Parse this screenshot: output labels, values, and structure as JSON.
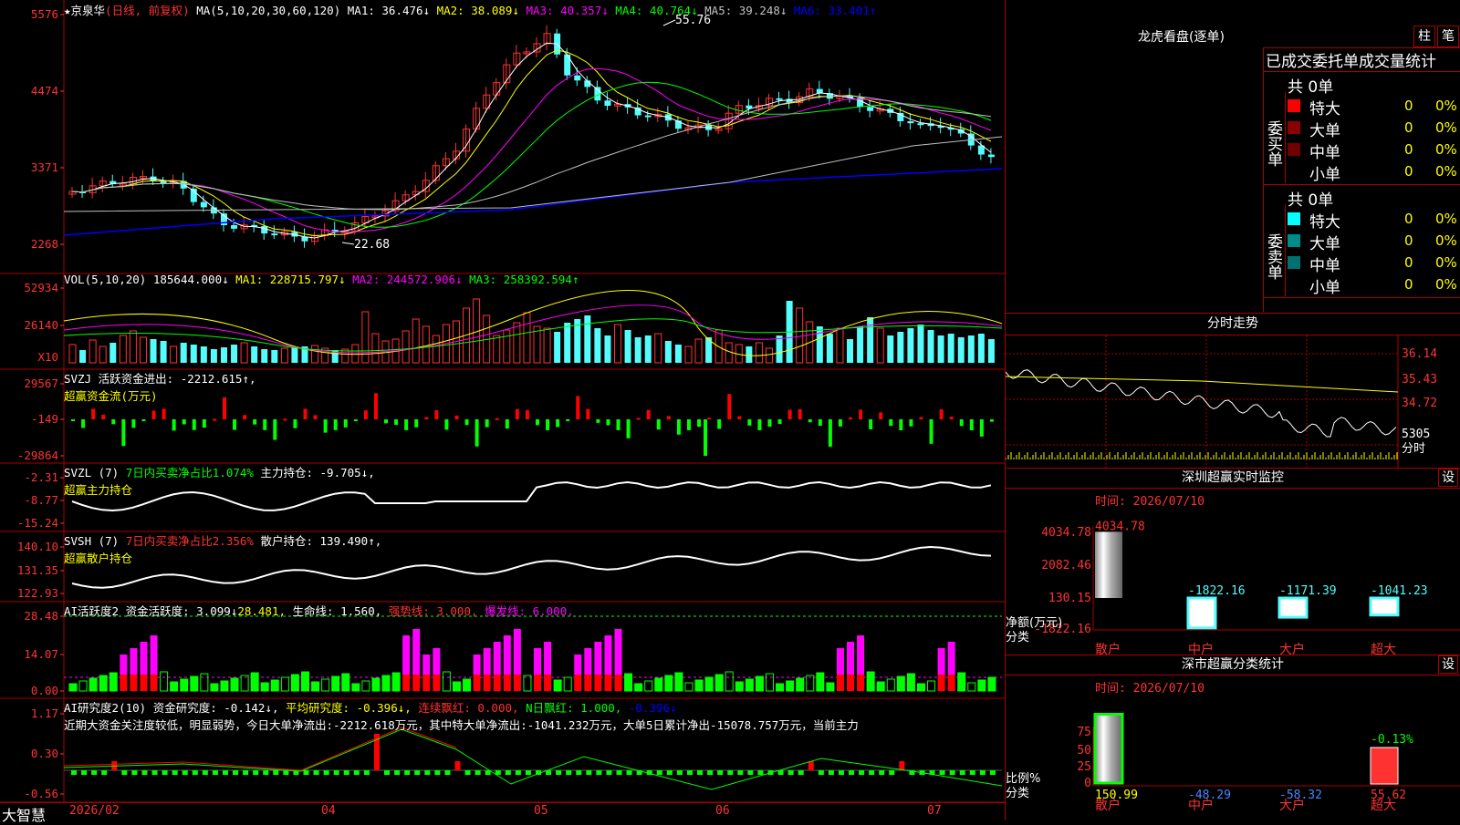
{
  "colors": {
    "up": "#ff3232",
    "down": "#54fcfc",
    "ma1": "#ffffff",
    "ma2": "#ffff00",
    "ma3": "#ff00ff",
    "ma4": "#00ff00",
    "ma5": "#c0c0c0",
    "ma6": "#0000ff",
    "magenta": "#ff00ff",
    "border": "#aa0000"
  },
  "main": {
    "star": "★",
    "stock": "京泉华",
    "mode": "(日线, 前复权)",
    "ma_def": "MA(5,10,20,30,60,120)",
    "ma": [
      {
        "label": "MA1: 36.476↓",
        "color": "#ffffff"
      },
      {
        "label": "MA2: 38.089↓",
        "color": "#ffff00"
      },
      {
        "label": "MA3: 40.357↓",
        "color": "#ff00ff"
      },
      {
        "label": "MA4: 40.764↓",
        "color": "#00ff00"
      },
      {
        "label": "MA5: 39.248↓",
        "color": "#c0c0c0"
      },
      {
        "label": "MA6: 33.401↑",
        "color": "#0000ff"
      }
    ],
    "yticks": [
      "5576",
      "4474",
      "3371",
      "2268"
    ],
    "high_label": "55.76",
    "low_label": "22.68"
  },
  "vol": {
    "title": "VOL(5,10,20)",
    "value": "185644.000↓",
    "ma1": "MA1: 228715.797↓",
    "ma2": "MA2: 244572.906↓",
    "ma3": "MA3: 258392.594↑",
    "yticks": [
      "52934",
      "26140"
    ],
    "unit": "X10"
  },
  "svzj": {
    "title": "SVZJ",
    "label": "活跃资金进出: -2212.615↑,",
    "sub": "超赢资金流(万元)",
    "yticks": [
      "29567",
      "-149",
      "-29864"
    ]
  },
  "svzl": {
    "title": "SVZL (7)",
    "label1": "7日内买卖净占比1.074%",
    "label2": "主力持仓: -9.705↓,",
    "sub": "超赢主力持仓",
    "yticks": [
      "-2.31",
      "-8.77",
      "-15.24"
    ]
  },
  "svsh": {
    "title": "SVSH (7)",
    "label1": "7日内买卖净占比2.356%",
    "label2": "散户持仓: 139.490↑,",
    "sub": "超赢散户持仓",
    "yticks": [
      "140.10",
      "131.35",
      "122.93"
    ]
  },
  "ai1": {
    "title": "AI活跃度2",
    "l1": "资金活跃度: 3.099↓",
    "l2": "28.481,",
    "l3": "生命线: 1.560,",
    "l4": "强势线: 3.000,",
    "l5": "爆发线: 6.000,",
    "yticks": [
      "28.48",
      "14.07",
      "0.00"
    ]
  },
  "ai2": {
    "title": "AI研究度2(10)",
    "l1": "资金研究度: -0.142↓,",
    "l2": "平均研究度: -0.396↓,",
    "l3": "连续飘红: 0.000,",
    "l4": "N日飘红: 1.000,",
    "l5": "-0.396↓",
    "text": "近期大资金关注度较低，明显弱势，今日大单净流出:-2212.618万元，其中特大单净流出:-1041.232万元，大单5日累计净出-15078.757万元，当前主力",
    "yticks": [
      "1.17",
      "0.30",
      "-0.56"
    ]
  },
  "bottom": {
    "brand": "大智慧",
    "dates": [
      "2026/02",
      "04",
      "05",
      "06",
      "07"
    ]
  },
  "lhb": {
    "title": "龙虎看盘(逐单)",
    "btn1": "柱",
    "btn2": "笔",
    "tabs": "已成交委托单成交量统计",
    "buy": {
      "vert": "委买单",
      "total": "共 0单",
      "rows": [
        {
          "name": "特大",
          "c": "#ff0000",
          "v": "0",
          "p": "0%"
        },
        {
          "name": "大单",
          "c": "#8b0000",
          "v": "0",
          "p": "0%"
        },
        {
          "name": "中单",
          "c": "#700000",
          "v": "0",
          "p": "0%"
        },
        {
          "name": "小单",
          "c": "",
          "v": "0",
          "p": "0%"
        }
      ]
    },
    "sell": {
      "vert": "委卖单",
      "total": "共 0单",
      "rows": [
        {
          "name": "特大",
          "c": "#00ffff",
          "v": "0",
          "p": "0%"
        },
        {
          "name": "大单",
          "c": "#008b8b",
          "v": "0",
          "p": "0%"
        },
        {
          "name": "中单",
          "c": "#007070",
          "v": "0",
          "p": "0%"
        },
        {
          "name": "小单",
          "c": "",
          "v": "0",
          "p": "0%"
        }
      ]
    }
  },
  "fs": {
    "title": "分时走势",
    "yticks": [
      "36.14",
      "35.43",
      "34.72"
    ],
    "vol": "5305",
    "unit": "分时"
  },
  "sz1": {
    "title": "深圳超赢实时监控",
    "btn": "设",
    "time": "时间: 2026/07/10",
    "yticks": [
      "4034.78",
      "2082.46",
      "130.15",
      "-1822.16"
    ],
    "ylab1": "净额(万元)",
    "ylab2": "分类",
    "chart_data": {
      "type": "bar",
      "categories": [
        "散户",
        "中户",
        "大户",
        "超大"
      ],
      "values": [
        4034.78,
        -1822.16,
        -1171.39,
        -1041.23
      ],
      "labels": [
        "4034.78",
        "-1822.16",
        "-1171.39",
        "-1041.23"
      ]
    }
  },
  "sz2": {
    "title": "深市超赢分类统计",
    "btn": "设",
    "time": "时间: 2026/07/10",
    "yticks": [
      "75",
      "50",
      "25",
      "0"
    ],
    "ylab1": "比例%",
    "ylab2": "分类",
    "top_label": "-0.13%",
    "chart_data": {
      "type": "bar",
      "categories": [
        "散户",
        "中户",
        "大户",
        "超大"
      ],
      "values": [
        150.99,
        -48.29,
        -58.32,
        55.62
      ],
      "labels": [
        "150.99",
        "-48.29",
        "-58.32",
        "55.62"
      ]
    }
  }
}
